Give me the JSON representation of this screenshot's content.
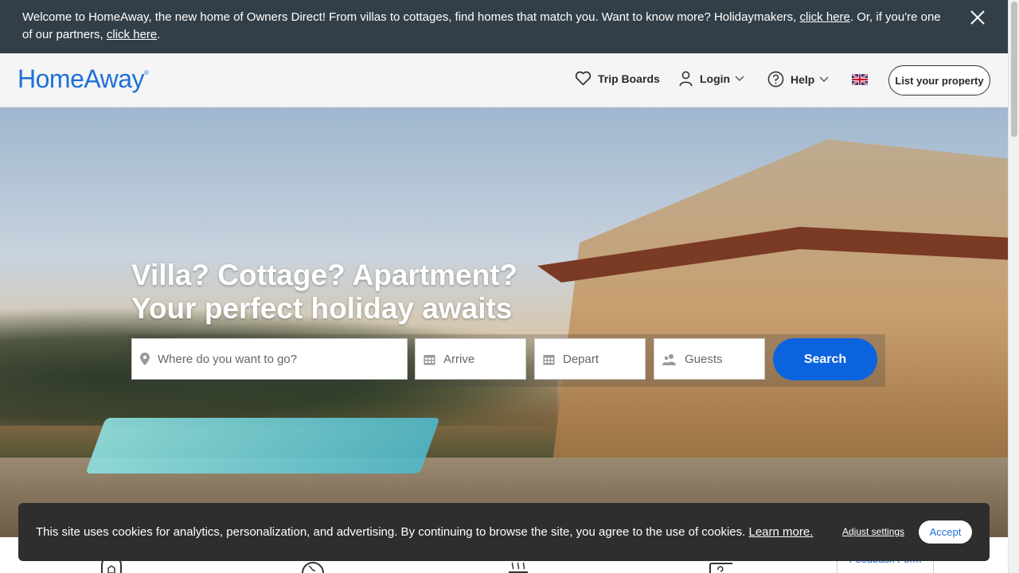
{
  "banner": {
    "text_1": "Welcome to HomeAway, the new home of Owners Direct! From villas to cottages, find homes that match you. Want to know more? Holidaymakers, ",
    "link_1": "click here",
    "text_2": ". Or, if you're one of our partners, ",
    "link_2": "click here",
    "text_3": "."
  },
  "header": {
    "logo": "HomeAway",
    "logo_mark": "®",
    "trip_boards": "Trip Boards",
    "login": "Login",
    "help": "Help",
    "list_property": "List your property"
  },
  "hero": {
    "headline_1": "Villa? Cottage? Apartment?",
    "headline_2": "Your perfect holiday awaits"
  },
  "search": {
    "where_placeholder": "Where do you want to go?",
    "arrive_placeholder": "Arrive",
    "depart_placeholder": "Depart",
    "guests_placeholder": "Guests",
    "button": "Search"
  },
  "cookie": {
    "text": "This site uses cookies for analytics, personalization, and advertising. By continuing to browse the site, you agree to the use of cookies. ",
    "learn_more": "Learn more.",
    "adjust": "Adjust settings",
    "accept": "Accept"
  },
  "feedback": "Feedback Form",
  "colors": {
    "banner_bg": "#333f48",
    "brand_blue": "#1e6fd9",
    "search_button": "#0b63de",
    "cookie_bg": "#2e2e2e"
  }
}
